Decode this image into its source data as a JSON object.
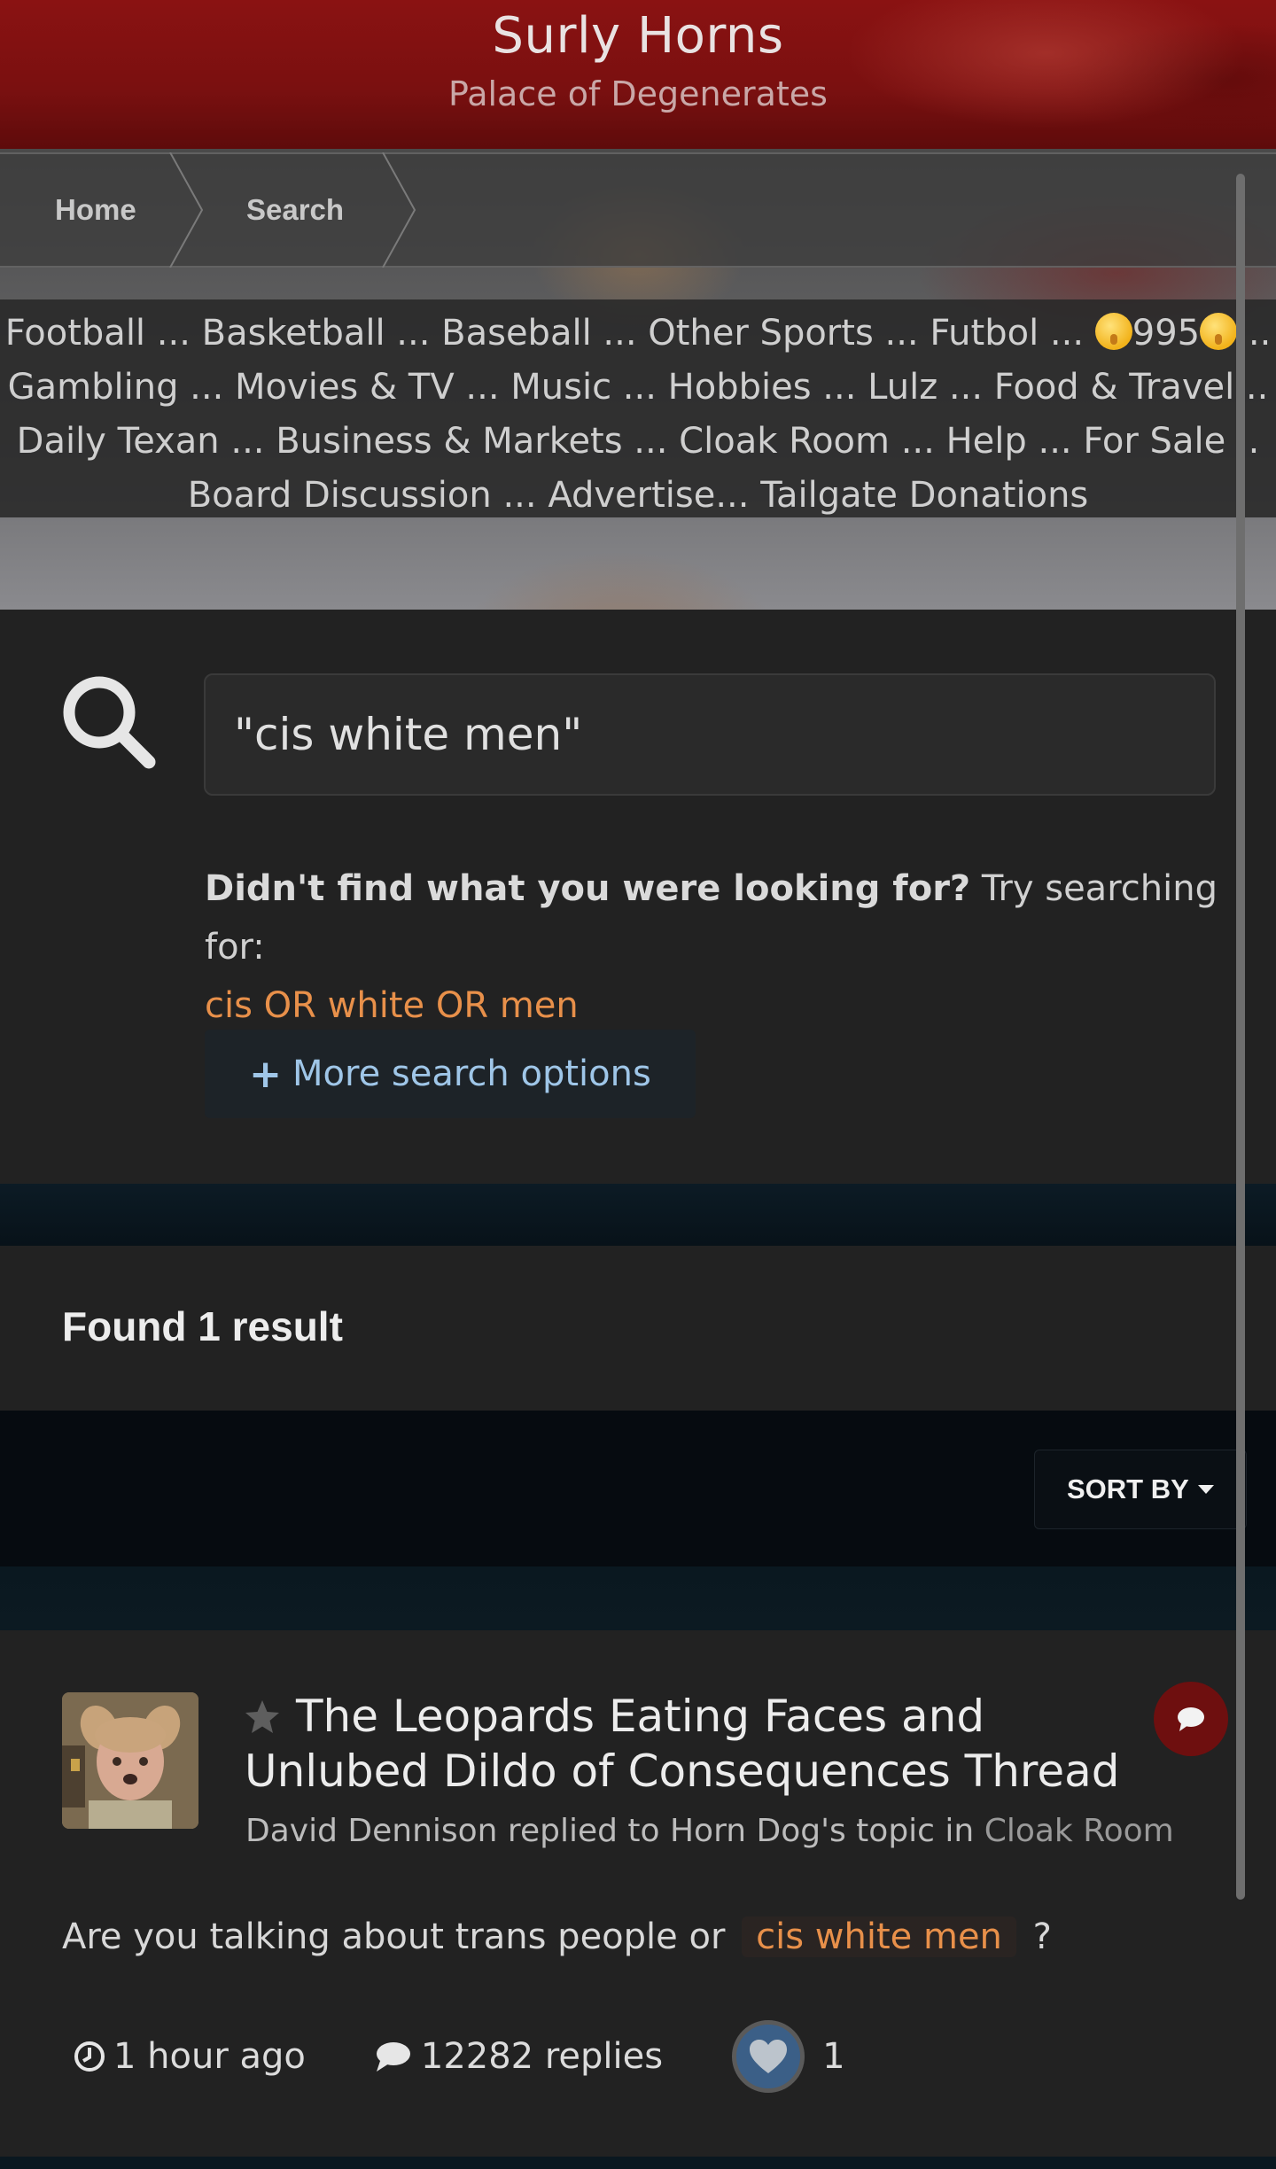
{
  "header": {
    "site_title": "Surly Horns",
    "tagline": "Palace of Degenerates"
  },
  "breadcrumb": {
    "items": [
      {
        "label": "Home"
      },
      {
        "label": "Search"
      }
    ]
  },
  "nav": {
    "lines": [
      [
        "Football",
        "Basketball",
        "Baseball",
        "Other Sports",
        "Futbol",
        "995"
      ],
      [
        "Gambling",
        "Movies & TV",
        "Music",
        "Hobbies",
        "Lulz",
        "Food & Travel"
      ],
      [
        "Daily Texan",
        "Business & Markets",
        "Cloak Room",
        "Help",
        "For Sale"
      ],
      [
        "Board Discussion",
        "Advertise",
        "Tailgate Donations"
      ]
    ],
    "separator": " ... ",
    "emoji_icon": "shushing-face-icon"
  },
  "search": {
    "query": "\"cis white men\"",
    "suggest_prefix": "Didn't find what you were looking for?",
    "suggest_text": "Try searching for:",
    "suggest_link": "cis OR white OR men",
    "more_options_label": "More search options"
  },
  "results": {
    "found_label": "Found 1 result",
    "sort_label": "SORT BY",
    "items": [
      {
        "title": "The Leopards Eating Faces and Unlubed Dildo of Consequences Thread",
        "meta_prefix": "David Dennison replied to Horn Dog's topic in",
        "forum": "Cloak Room",
        "snippet_before": "Are you talking about trans people or",
        "snippet_highlight": "cis white men",
        "snippet_after": "?",
        "time": "1 hour ago",
        "replies": "12282 replies",
        "likes": "1"
      }
    ]
  },
  "colors": {
    "header_red": "#7a1010",
    "link_orange": "#e8904a",
    "button_blue_text": "#9fc6e8",
    "badge_red": "#6e0f0f",
    "like_blue": "#3b5f87"
  }
}
